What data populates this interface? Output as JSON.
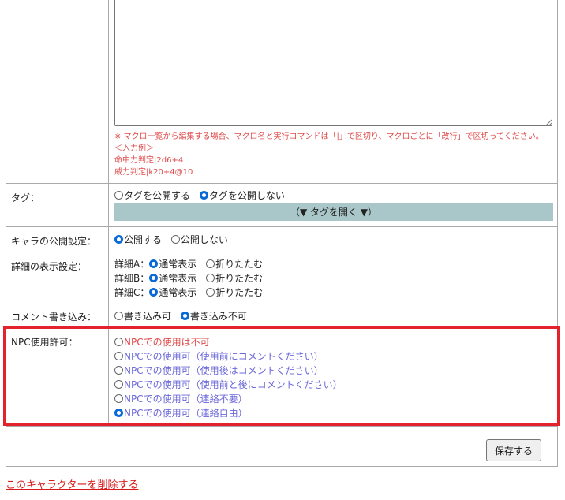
{
  "macro": {
    "note": "※ マクロ一覧から編集する場合、マクロ名と実行コマンドは「|」で区切り、マクロごとに「改行」で区切ってください。",
    "example_title": "＜入力例＞",
    "example_lines": [
      "命中力判定|2d6+4",
      "威力判定|k20+4@10"
    ]
  },
  "tags": {
    "label": "タグ：",
    "options": [
      "タグを公開する",
      "タグを公開しない"
    ],
    "selected": 1,
    "toggle_label": "（▼ タグを開く ▼）"
  },
  "visibility": {
    "label": "キャラの公開設定：",
    "options": [
      "公開する",
      "公開しない"
    ],
    "selected": 0
  },
  "detail": {
    "label": "詳細の表示設定：",
    "rows": [
      {
        "name": "詳細A：",
        "options": [
          "通常表示",
          "折りたたむ"
        ],
        "selected": 0
      },
      {
        "name": "詳細B：",
        "options": [
          "通常表示",
          "折りたたむ"
        ],
        "selected": 0
      },
      {
        "name": "詳細C：",
        "options": [
          "通常表示",
          "折りたたむ"
        ],
        "selected": 0
      }
    ]
  },
  "comment": {
    "label": "コメント書き込み：",
    "options": [
      "書き込み可",
      "書き込み不可"
    ],
    "selected": 1
  },
  "npc": {
    "label": "NPC使用許可：",
    "options": [
      "NPCでの使用は不可",
      "NPCでの使用可（使用前にコメントください）",
      "NPCでの使用可（使用後はコメントください）",
      "NPCでの使用可（使用前と後にコメントください）",
      "NPCでの使用可（連絡不要）",
      "NPCでの使用可（連絡自由）"
    ],
    "selected": 5
  },
  "actions": {
    "save_label": "保存する",
    "delete_label": "このキャラクターを削除する"
  },
  "colors": {
    "highlight": "#e3222c",
    "tag_bar": "#a9c7c9",
    "note_red": "#e04b4b",
    "npc_blue": "#6b68d9",
    "radio_on": "#0a6ad8"
  }
}
